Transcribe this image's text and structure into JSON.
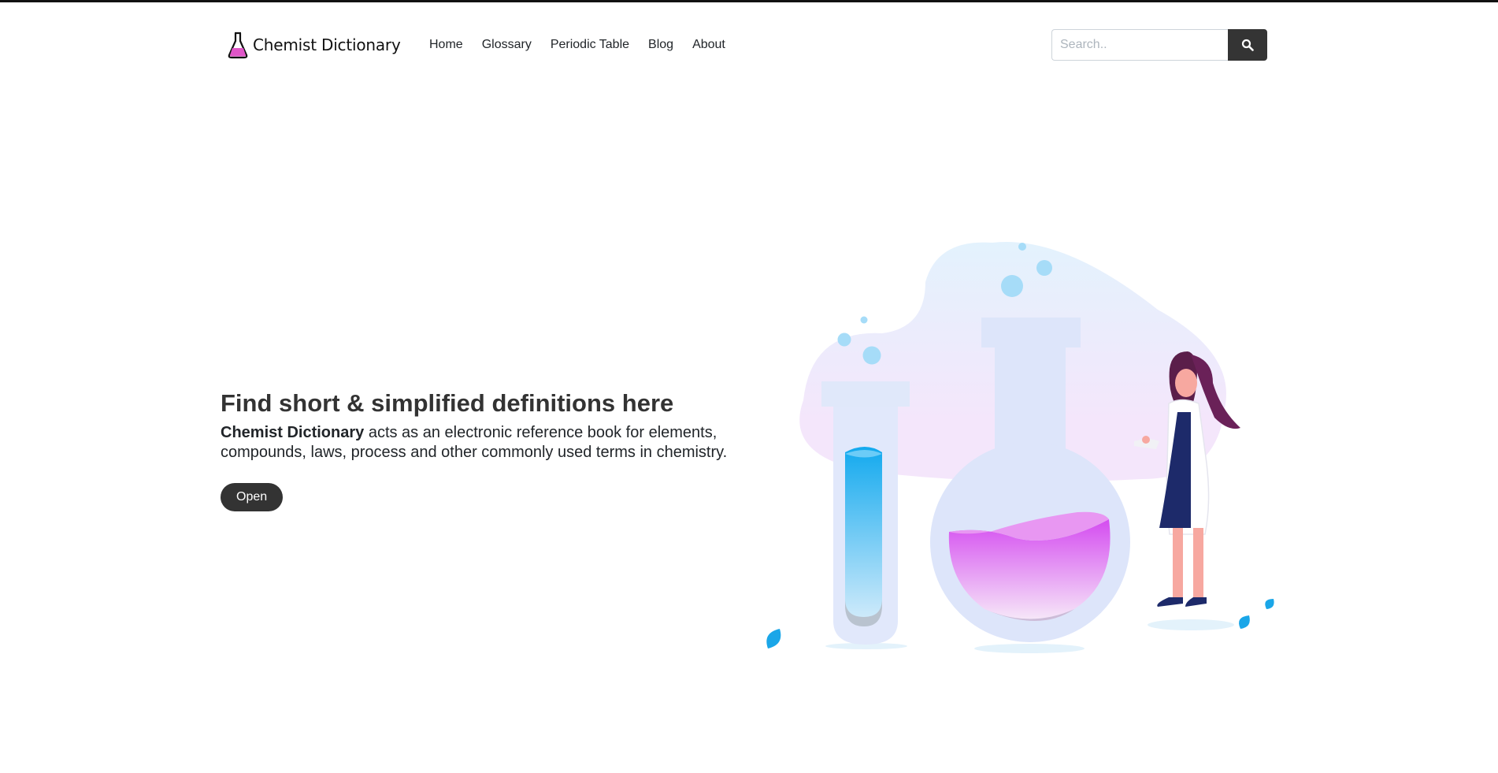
{
  "navbar": {
    "brand": {
      "name": "Chemist Dictionary",
      "icon": "flask-icon"
    },
    "links": [
      {
        "label": "Home"
      },
      {
        "label": "Glossary"
      },
      {
        "label": "Periodic Table"
      },
      {
        "label": "Blog"
      },
      {
        "label": "About"
      }
    ],
    "search": {
      "placeholder": "Search..",
      "value": "",
      "button_icon": "search-icon"
    }
  },
  "hero": {
    "title": "Find short & simplified definitions here",
    "description_bold": "Chemist Dictionary",
    "description_rest": " acts as an electronic reference book for elements, compounds, laws, process and other commonly used terms in chemistry.",
    "button_label": "Open"
  },
  "colors": {
    "dark": "#333333",
    "accent_pink": "#e66ee6",
    "accent_blue": "#1fb2f5",
    "blob": "#eaf2fd"
  }
}
